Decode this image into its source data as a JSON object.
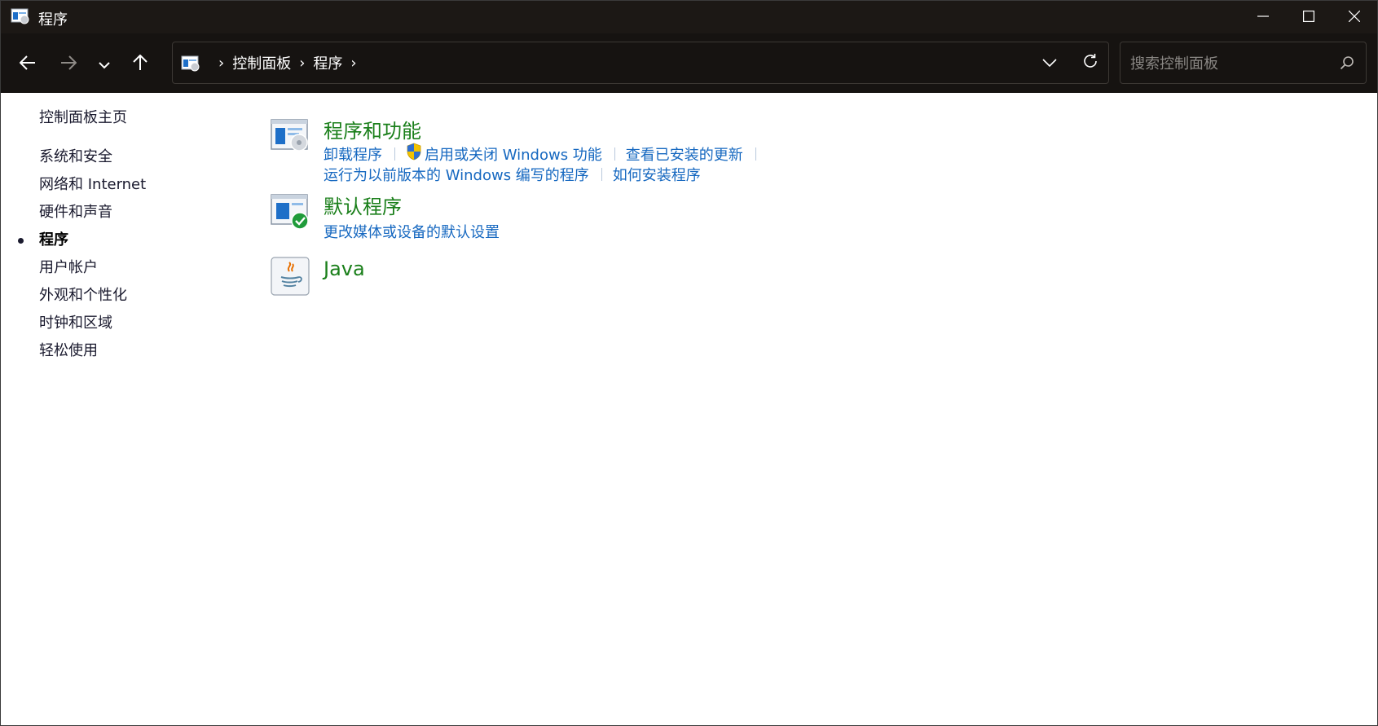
{
  "window": {
    "title": "程序",
    "controls": [
      "minimize",
      "maximize",
      "close"
    ]
  },
  "toolbar": {
    "breadcrumb": [
      "控制面板",
      "程序"
    ],
    "search_placeholder": "搜索控制面板"
  },
  "sidebar": {
    "home_label": "控制面板主页",
    "items": [
      {
        "label": "系统和安全",
        "active": false
      },
      {
        "label": "网络和 Internet",
        "active": false
      },
      {
        "label": "硬件和声音",
        "active": false
      },
      {
        "label": "程序",
        "active": true
      },
      {
        "label": "用户帐户",
        "active": false
      },
      {
        "label": "外观和个性化",
        "active": false
      },
      {
        "label": "时钟和区域",
        "active": false
      },
      {
        "label": "轻松使用",
        "active": false
      }
    ]
  },
  "categories": [
    {
      "title": "程序和功能",
      "icon": "programs-features-icon",
      "links": [
        "卸载程序",
        "启用或关闭 Windows 功能",
        "查看已安装的更新",
        "运行为以前版本的 Windows 编写的程序",
        "如何安装程序"
      ]
    },
    {
      "title": "默认程序",
      "icon": "default-programs-icon",
      "links": [
        "更改媒体或设备的默认设置"
      ]
    },
    {
      "title": "Java",
      "icon": "java-icon",
      "links": []
    }
  ],
  "colors": {
    "title_bar": "#1c1815",
    "toolbar": "#161311",
    "category_title": "#1a7f1a",
    "link": "#1668c0"
  }
}
